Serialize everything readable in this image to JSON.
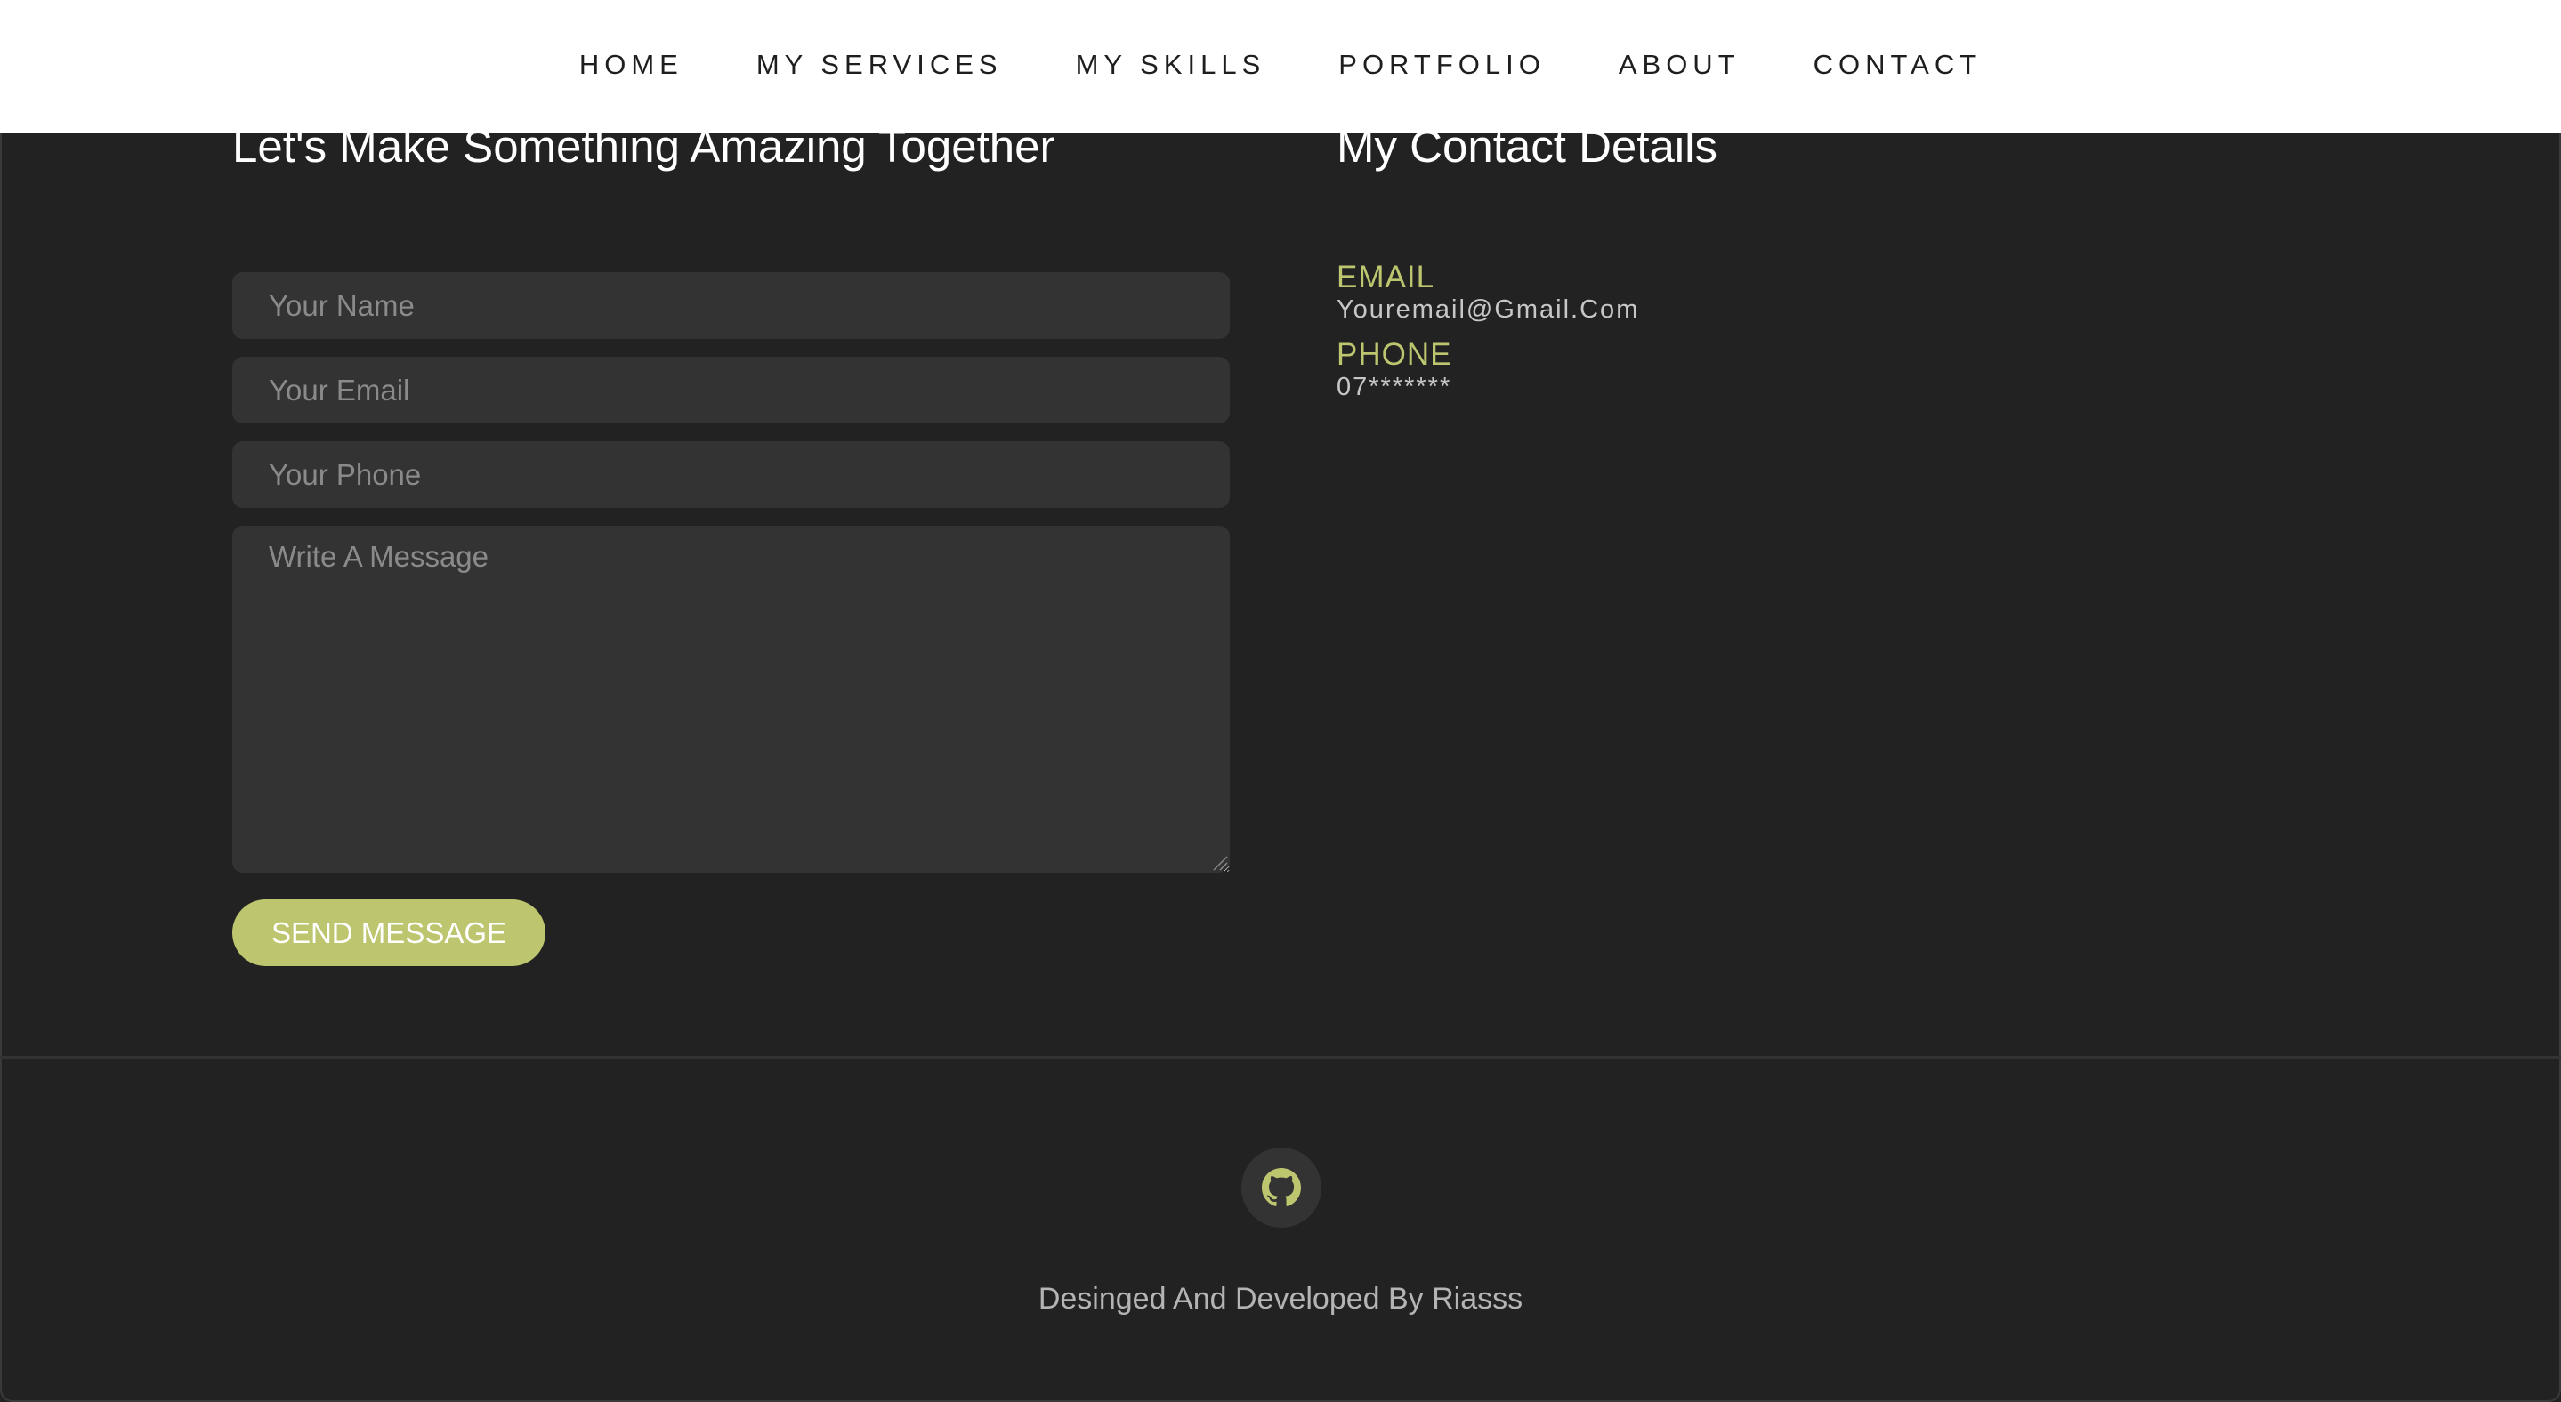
{
  "nav": {
    "items": [
      {
        "label": "HOME"
      },
      {
        "label": "MY SERVICES"
      },
      {
        "label": "MY SKILLS"
      },
      {
        "label": "PORTFOLIO"
      },
      {
        "label": "ABOUT"
      },
      {
        "label": "CONTACT"
      }
    ]
  },
  "form": {
    "title": "Let's Make Something Amazing Together",
    "name_placeholder": "Your Name",
    "email_placeholder": "Your Email",
    "phone_placeholder": "Your Phone",
    "message_placeholder": "Write A Message",
    "send_label": "SEND MESSAGE"
  },
  "details": {
    "title": "My Contact Details",
    "email_label": "EMAIL",
    "email_value": "Youremail@Gmail.Com",
    "phone_label": "PHONE",
    "phone_value": "07*******"
  },
  "footer": {
    "social_icon": "github-icon",
    "credit": "Desinged And Developed By Riasss"
  },
  "colors": {
    "accent": "#bdc66f",
    "background": "#222222",
    "field_bg": "#333333",
    "nav_bg": "#ffffff"
  }
}
